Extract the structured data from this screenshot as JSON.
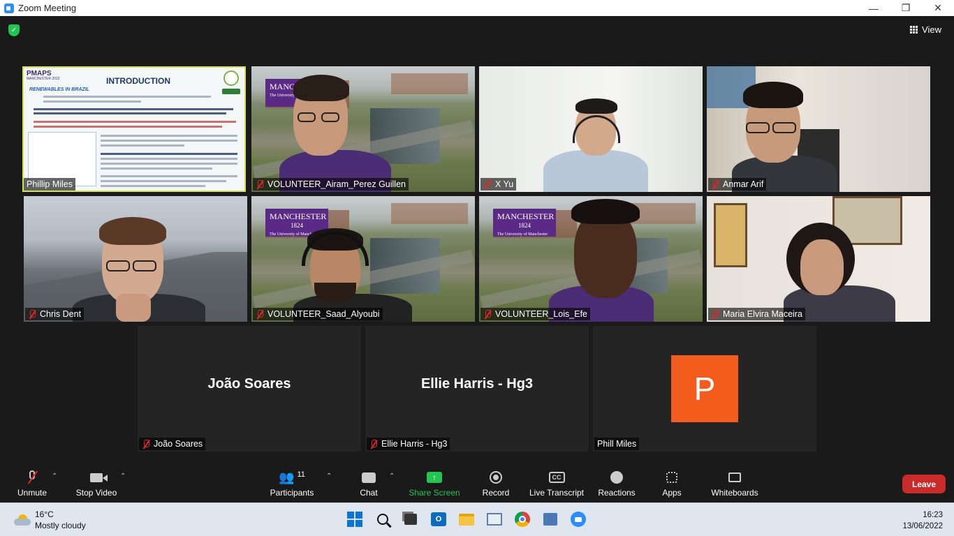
{
  "window": {
    "title": "Zoom Meeting",
    "minimize": "—",
    "restore": "❐",
    "close": "✕"
  },
  "header": {
    "view_label": "View"
  },
  "tiles": [
    {
      "name": "Phillip Miles",
      "kind": "slide",
      "muted": false
    },
    {
      "name": "VOLUNTEER_Airam_Perez Guillen",
      "kind": "campus",
      "muted": true
    },
    {
      "name": "X Yu",
      "kind": "video",
      "muted": true
    },
    {
      "name": "Anmar Arif",
      "kind": "video",
      "muted": true
    },
    {
      "name": "Chris Dent",
      "kind": "video",
      "muted": true
    },
    {
      "name": "VOLUNTEER_Saad_Alyoubi",
      "kind": "campus",
      "muted": true
    },
    {
      "name": "VOLUNTEER_Lois_Efe",
      "kind": "campus",
      "muted": true
    },
    {
      "name": "Maria Elvira Maceira",
      "kind": "video",
      "muted": true
    },
    {
      "name": "João Soares",
      "kind": "plain",
      "display": "João Soares",
      "muted": true
    },
    {
      "name": "Ellie Harris - Hg3",
      "kind": "plain",
      "display": "Ellie Harris - Hg3",
      "muted": true
    },
    {
      "name": "Phill Miles",
      "kind": "avatar",
      "initial": "P",
      "muted": false
    }
  ],
  "slide": {
    "logo": "PMAPS",
    "logo_sub": "MANCHESTER 2022",
    "title": "INTRODUCTION",
    "section": "RENEWABLES IN BRAZIL"
  },
  "manchester_logo": {
    "name": "MANCHESTER",
    "year": "1824",
    "sub": "The University of Manchester"
  },
  "toolbar": {
    "unmute": "Unmute",
    "stop_video": "Stop Video",
    "participants": "Participants",
    "participant_count": "11",
    "chat": "Chat",
    "share_screen": "Share Screen",
    "record": "Record",
    "live_transcript": "Live Transcript",
    "reactions": "Reactions",
    "apps": "Apps",
    "whiteboards": "Whiteboards",
    "leave": "Leave"
  },
  "taskbar": {
    "temperature": "16°C",
    "weather": "Mostly cloudy",
    "time": "16:23",
    "date": "13/06/2022"
  },
  "colors": {
    "share_green": "#23c552",
    "leave_red": "#c92b2b",
    "avatar_orange": "#f35c1d",
    "manchester_purple": "#5b2a86"
  }
}
